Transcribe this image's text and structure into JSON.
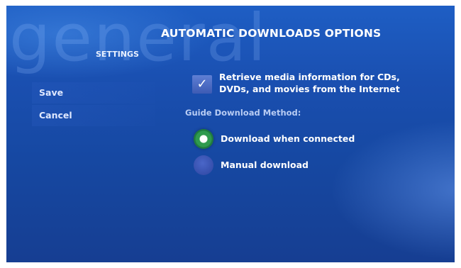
{
  "page": {
    "watermark": "general",
    "section": "SETTINGS",
    "title": "AUTOMATIC DOWNLOADS OPTIONS"
  },
  "sidebar": {
    "buttons": [
      {
        "label": "Save"
      },
      {
        "label": "Cancel"
      }
    ]
  },
  "options": {
    "media_info": {
      "checked": true,
      "label_line1": "Retrieve media information for CDs,",
      "label_line2": "DVDs, and movies from the Internet"
    },
    "guide_method": {
      "label": "Guide Download Method:",
      "choices": [
        {
          "label": "Download when connected",
          "selected": true
        },
        {
          "label": "Manual download",
          "selected": false
        }
      ]
    }
  },
  "colors": {
    "background": "#1a4fb0",
    "selected_radio": "#2f9a4e"
  }
}
